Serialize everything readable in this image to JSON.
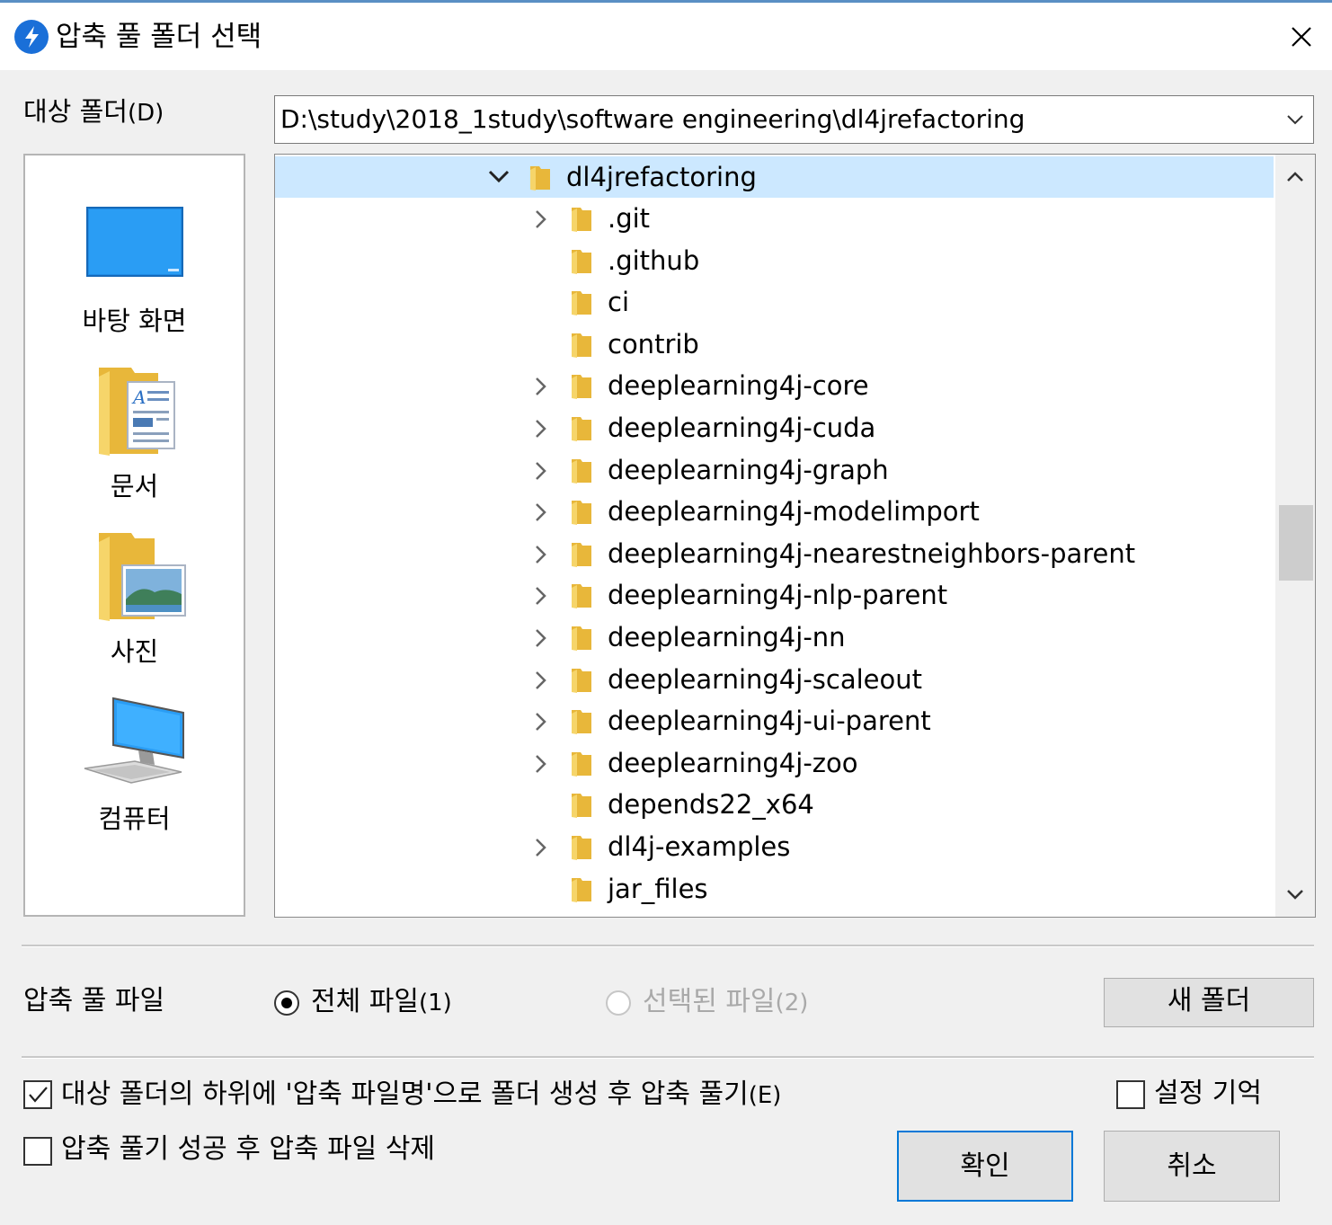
{
  "window": {
    "title": "압축 풀 폴더 선택"
  },
  "target_folder": {
    "label": "대상 폴더",
    "label_key": "(D)",
    "path": "D:\\study\\2018_1study\\software engineering\\dl4jrefactoring"
  },
  "places": [
    {
      "label": "바탕 화면",
      "icon": "desktop-icon"
    },
    {
      "label": "문서",
      "icon": "documents-icon"
    },
    {
      "label": "사진",
      "icon": "pictures-icon"
    },
    {
      "label": "컴퓨터",
      "icon": "computer-icon"
    }
  ],
  "tree": {
    "selected": {
      "name": "dl4jrefactoring",
      "expanded": true
    },
    "children": [
      {
        "name": ".git",
        "has_children": true
      },
      {
        "name": ".github",
        "has_children": false
      },
      {
        "name": "ci",
        "has_children": false
      },
      {
        "name": "contrib",
        "has_children": false
      },
      {
        "name": "deeplearning4j-core",
        "has_children": true
      },
      {
        "name": "deeplearning4j-cuda",
        "has_children": true
      },
      {
        "name": "deeplearning4j-graph",
        "has_children": true
      },
      {
        "name": "deeplearning4j-modelimport",
        "has_children": true
      },
      {
        "name": "deeplearning4j-nearestneighbors-parent",
        "has_children": true
      },
      {
        "name": "deeplearning4j-nlp-parent",
        "has_children": true
      },
      {
        "name": "deeplearning4j-nn",
        "has_children": true
      },
      {
        "name": "deeplearning4j-scaleout",
        "has_children": true
      },
      {
        "name": "deeplearning4j-ui-parent",
        "has_children": true
      },
      {
        "name": "deeplearning4j-zoo",
        "has_children": true
      },
      {
        "name": "depends22_x64",
        "has_children": false
      },
      {
        "name": "dl4j-examples",
        "has_children": true
      },
      {
        "name": "jar_files",
        "has_children": false
      }
    ]
  },
  "extract_files": {
    "label": "압축 풀 파일",
    "all_label": "전체 파일",
    "all_key": "(1)",
    "selected_label": "선택된 파일",
    "selected_key": "(2)",
    "new_folder_label": "새 폴더"
  },
  "options": {
    "create_subfolder_label": "대상 폴더의 하위에 '압축 파일명'으로 폴더 생성 후 압축 풀기",
    "create_subfolder_key": "(E)",
    "create_subfolder_checked": true,
    "delete_after_label": "압축 풀기 성공 후 압축 파일 삭제",
    "delete_after_checked": false,
    "remember_label": "설정 기억",
    "remember_checked": false
  },
  "buttons": {
    "ok": "확인",
    "cancel": "취소"
  },
  "colors": {
    "selection": "#cce8ff",
    "accent": "#0078d7",
    "folder": "#f6c94b"
  }
}
